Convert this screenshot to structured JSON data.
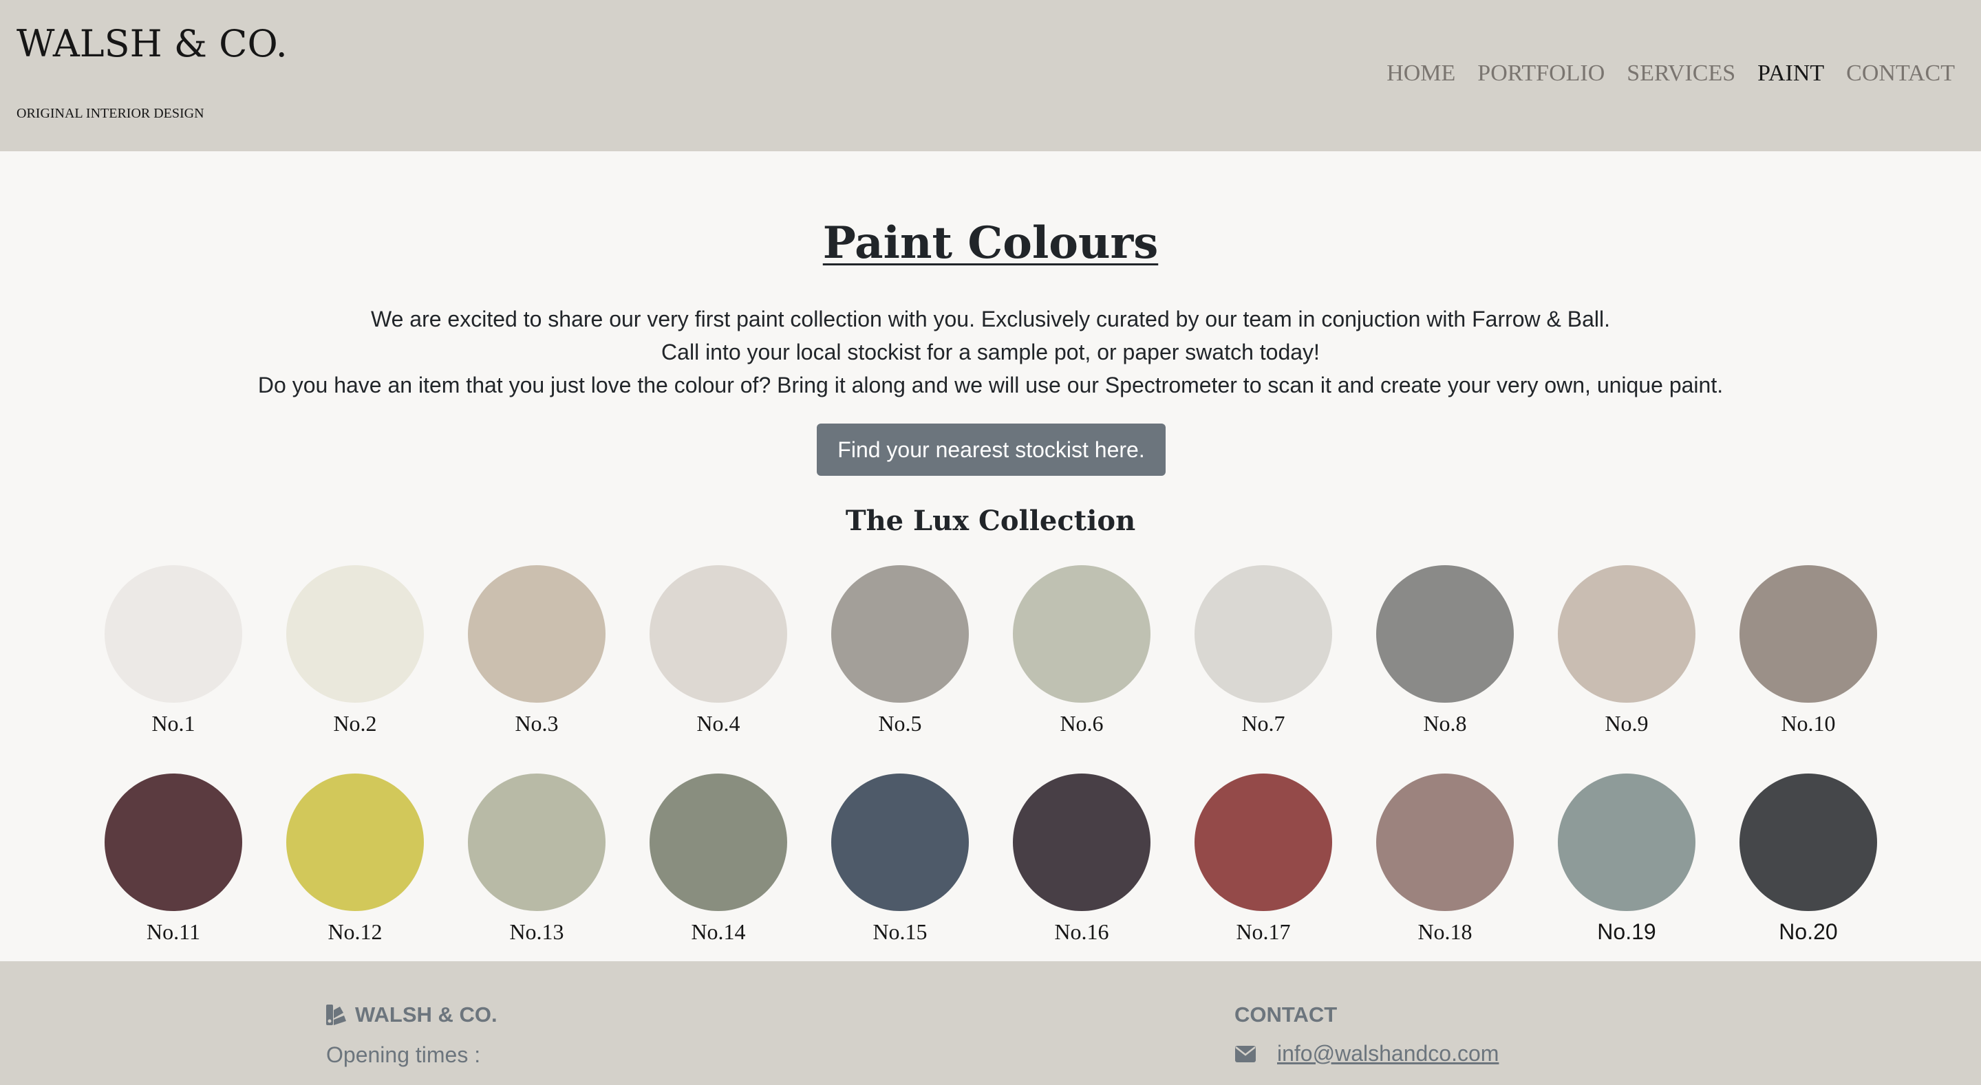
{
  "header": {
    "brand": "WALSH & CO.",
    "tagline": "ORIGINAL INTERIOR DESIGN",
    "nav": [
      {
        "label": "HOME",
        "active": false
      },
      {
        "label": "PORTFOLIO",
        "active": false
      },
      {
        "label": "SERVICES",
        "active": false
      },
      {
        "label": "PAINT",
        "active": true
      },
      {
        "label": "CONTACT",
        "active": false
      }
    ]
  },
  "main": {
    "title": "Paint Colours",
    "intro_lines": [
      "We are excited to share our very first paint collection with you. Exclusively curated by our team in conjuction with Farrow & Ball.",
      "Call into your local stockist for a sample pot, or paper swatch today!",
      "Do you have an item that you just love the colour of? Bring it along and we will use our Spectrometer to scan it and create your very own, unique paint."
    ],
    "cta_label": "Find your nearest stockist here.",
    "collection_title": "The Lux Collection",
    "swatches": [
      {
        "label": "No.1",
        "color": "#ece9e6"
      },
      {
        "label": "No.2",
        "color": "#eae8dc"
      },
      {
        "label": "No.3",
        "color": "#cbbfaf"
      },
      {
        "label": "No.4",
        "color": "#ddd8d2"
      },
      {
        "label": "No.5",
        "color": "#a39f99"
      },
      {
        "label": "No.6",
        "color": "#bfc1b2"
      },
      {
        "label": "No.7",
        "color": "#dad8d3"
      },
      {
        "label": "No.8",
        "color": "#8a8a88"
      },
      {
        "label": "No.9",
        "color": "#c9bdb2"
      },
      {
        "label": "No.10",
        "color": "#9b9088"
      },
      {
        "label": "No.11",
        "color": "#5b3b40"
      },
      {
        "label": "No.12",
        "color": "#d2c85a"
      },
      {
        "label": "No.13",
        "color": "#b8baa6"
      },
      {
        "label": "No.14",
        "color": "#898e7f"
      },
      {
        "label": "No.15",
        "color": "#4e5a69"
      },
      {
        "label": "No.16",
        "color": "#483f46"
      },
      {
        "label": "No.17",
        "color": "#944a49"
      },
      {
        "label": "No.18",
        "color": "#9c837e"
      },
      {
        "label": "No.19",
        "color": "#8e9b99"
      },
      {
        "label": "No.20",
        "color": "#45474a"
      }
    ]
  },
  "footer": {
    "brand": "WALSH & CO.",
    "brand_icon": "swatchbook-icon",
    "opening_label": "Opening times :",
    "contact_title": "CONTACT",
    "email_icon": "envelope-icon",
    "email": "info@walshandco.com"
  },
  "colors": {
    "header_bg": "#d4d1ca",
    "page_bg": "#f8f7f5",
    "button_bg": "#6c757d",
    "muted_text": "#6c757d"
  }
}
